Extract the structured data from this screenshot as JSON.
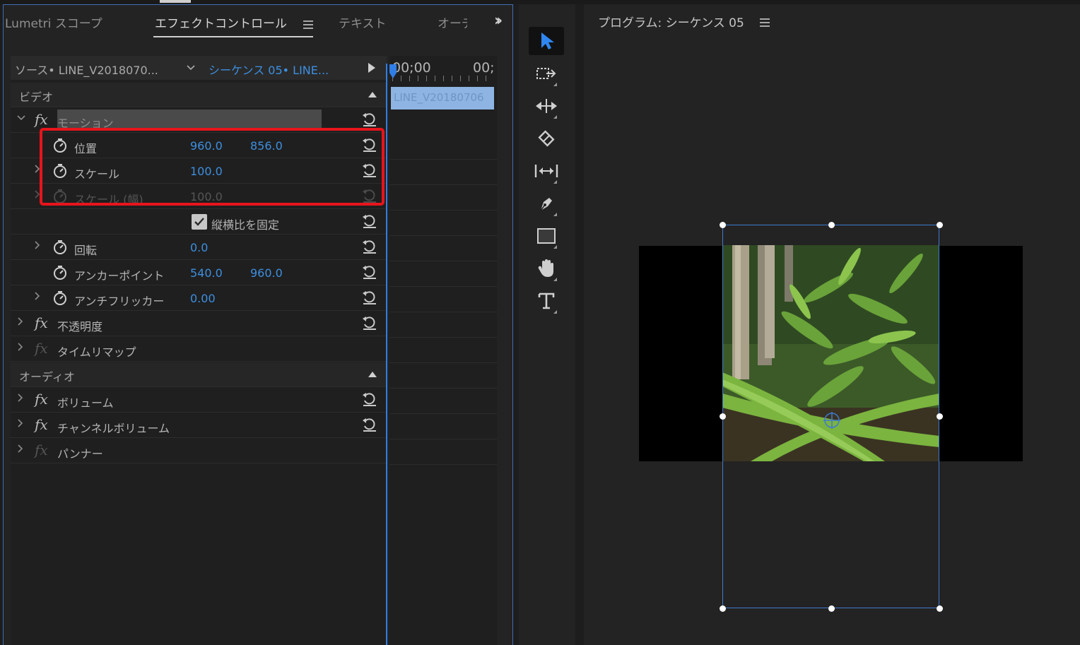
{
  "tabs": {
    "lumetri": "Lumetri スコープ",
    "effect_controls": "エフェクトコントロール",
    "text": "テキスト",
    "audio_truncated": "オーデ"
  },
  "source_row": {
    "source": "ソース• LINE_V2018070...",
    "sequence": "シーケンス 05• LINE..."
  },
  "timeline": {
    "timecode_start": "00;00",
    "timecode_end": "00;",
    "clip_name": "LINE_V20180706"
  },
  "sections": {
    "video": "ビデオ",
    "audio": "オーディオ"
  },
  "effects": {
    "motion": "モーション",
    "opacity": "不透明度",
    "time_remap": "タイムリマップ",
    "volume": "ボリューム",
    "channel_volume": "チャンネルボリューム",
    "panner": "パンナー"
  },
  "params": {
    "position": {
      "label": "位置",
      "x": "960.0",
      "y": "856.0"
    },
    "scale": {
      "label": "スケール",
      "value": "100.0"
    },
    "scale_width": {
      "label": "スケール (幅)",
      "value": "100.0"
    },
    "uniform_scale": {
      "label": "縦横比を固定",
      "checked": true
    },
    "rotation": {
      "label": "回転",
      "value": "0.0"
    },
    "anchor": {
      "label": "アンカーポイント",
      "x": "540.0",
      "y": "960.0"
    },
    "antiflicker": {
      "label": "アンチフリッカー",
      "value": "0.00"
    }
  },
  "tools": [
    "selection-tool",
    "track-select-tool",
    "ripple-edit-tool",
    "razor-tool",
    "slip-tool",
    "pen-tool",
    "rectangle-tool",
    "hand-tool",
    "type-tool"
  ],
  "program": {
    "title": "プログラム: シーケンス 05"
  },
  "colors": {
    "accent_blue": "#3d8fe0",
    "highlight_red": "#e8141c",
    "panel_border": "#3f6fb5"
  }
}
